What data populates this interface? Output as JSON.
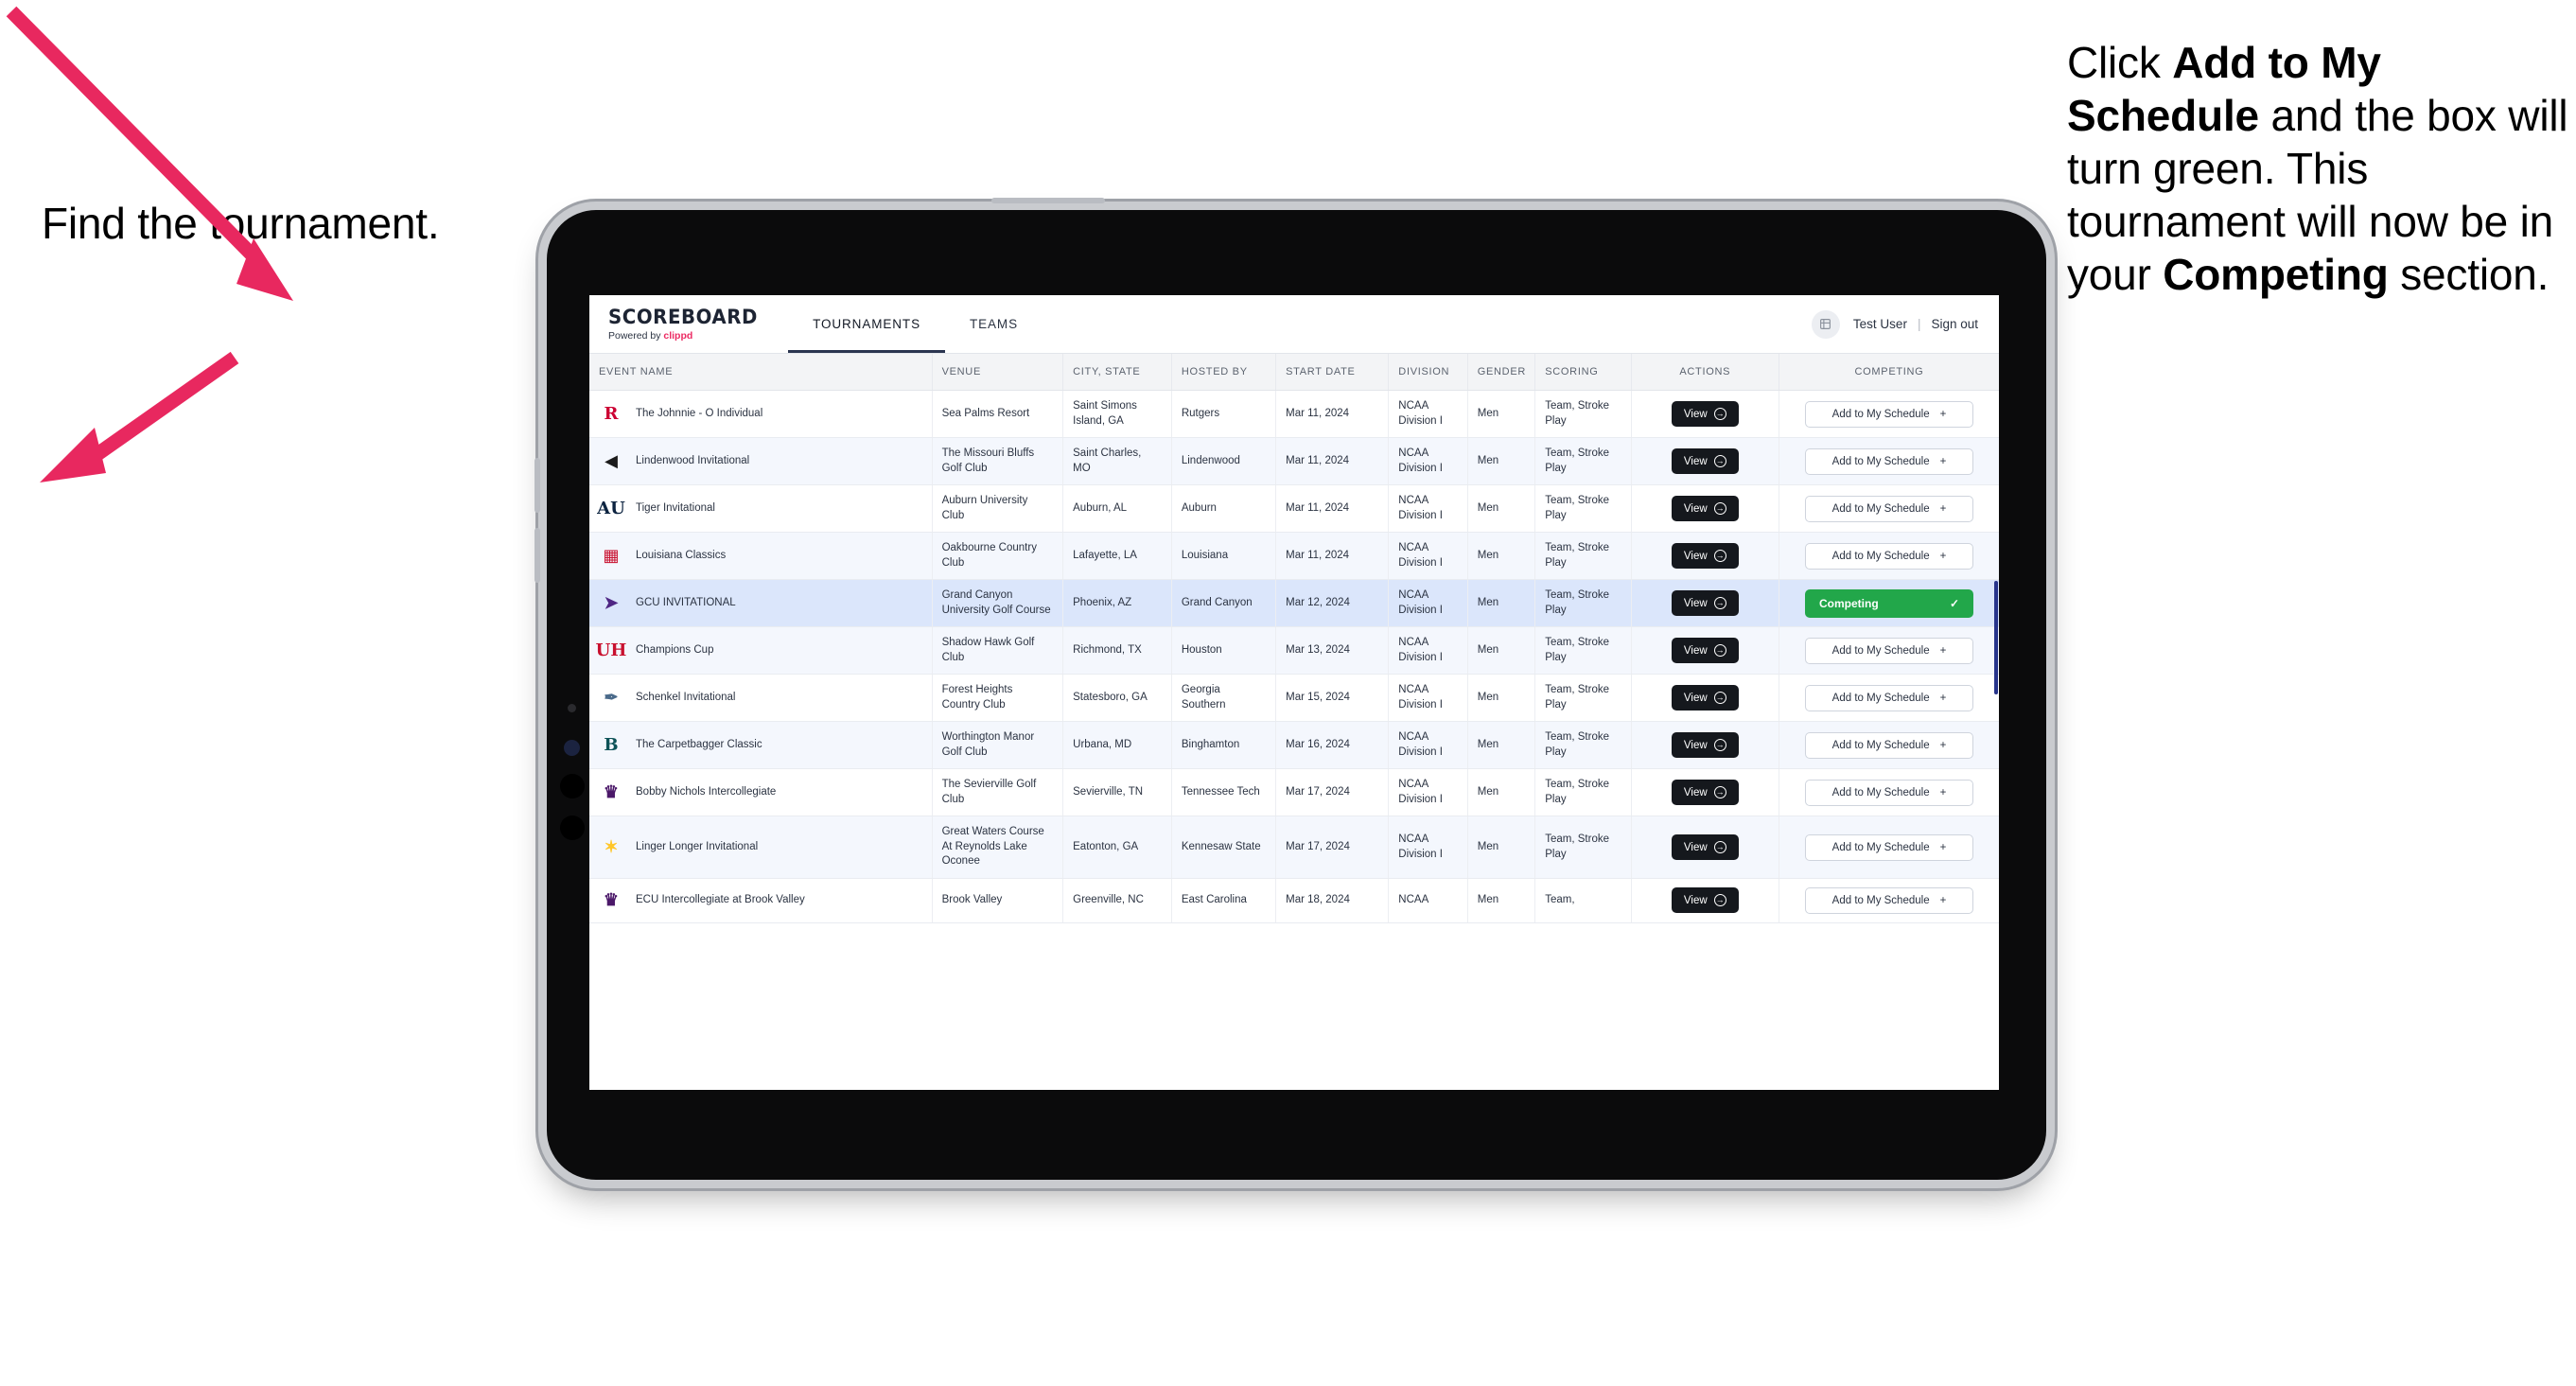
{
  "annotations": {
    "left": [
      {
        "t": "Find the tournament.",
        "b": false
      }
    ],
    "right": [
      {
        "t": "Click ",
        "b": false
      },
      {
        "t": "Add to My Schedule",
        "b": true
      },
      {
        "t": " and the box will turn green. This tournament will now be in your ",
        "b": false
      },
      {
        "t": "Competing",
        "b": true
      },
      {
        "t": " section.",
        "b": false
      }
    ],
    "arrow_color": "#E8285F"
  },
  "app": {
    "brand": {
      "name": "SCOREBOARD",
      "powered_prefix": "Powered by ",
      "powered_brand": "clippd"
    },
    "tabs": [
      {
        "label": "TOURNAMENTS",
        "active": true
      },
      {
        "label": "TEAMS",
        "active": false
      }
    ],
    "user": {
      "name": "Test User",
      "separator": "|",
      "signout": "Sign out",
      "avatar_icon": "user-avatar-icon"
    }
  },
  "table": {
    "columns": [
      "EVENT NAME",
      "VENUE",
      "CITY, STATE",
      "HOSTED BY",
      "START DATE",
      "DIVISION",
      "GENDER",
      "SCORING",
      "ACTIONS",
      "COMPETING"
    ],
    "buttons": {
      "view": "View",
      "add": "Add to My Schedule",
      "add_glyph": "+",
      "competing": "Competing",
      "competing_glyph": "✓",
      "view_glyph": "→"
    },
    "rows": [
      {
        "logo": {
          "text": "R",
          "color": "#CC0033",
          "name": "rutgers-logo"
        },
        "event": "The Johnnie - O Individual",
        "venue": "Sea Palms Resort",
        "city": "Saint Simons Island, GA",
        "hosted_by": "Rutgers",
        "start_date": "Mar 11, 2024",
        "division": "NCAA Division I",
        "gender": "Men",
        "scoring": "Team, Stroke Play",
        "competing": false
      },
      {
        "logo": {
          "text": "◀",
          "color": "#1b1b1b",
          "name": "lindenwood-logo"
        },
        "event": "Lindenwood Invitational",
        "venue": "The Missouri Bluffs Golf Club",
        "city": "Saint Charles, MO",
        "hosted_by": "Lindenwood",
        "start_date": "Mar 11, 2024",
        "division": "NCAA Division I",
        "gender": "Men",
        "scoring": "Team, Stroke Play",
        "competing": false
      },
      {
        "logo": {
          "text": "AU",
          "color": "#0C2340",
          "name": "auburn-logo"
        },
        "event": "Tiger Invitational",
        "venue": "Auburn University Club",
        "city": "Auburn, AL",
        "hosted_by": "Auburn",
        "start_date": "Mar 11, 2024",
        "division": "NCAA Division I",
        "gender": "Men",
        "scoring": "Team, Stroke Play",
        "competing": false
      },
      {
        "logo": {
          "text": "▦",
          "color": "#C8102E",
          "name": "louisiana-ragin-cajuns-logo"
        },
        "event": "Louisiana Classics",
        "venue": "Oakbourne Country Club",
        "city": "Lafayette, LA",
        "hosted_by": "Louisiana",
        "start_date": "Mar 11, 2024",
        "division": "NCAA Division I",
        "gender": "Men",
        "scoring": "Team, Stroke Play",
        "competing": false
      },
      {
        "logo": {
          "text": "➤",
          "color": "#4F2683",
          "name": "grand-canyon-lopes-logo"
        },
        "event": "GCU INVITATIONAL",
        "venue": "Grand Canyon University Golf Course",
        "city": "Phoenix, AZ",
        "hosted_by": "Grand Canyon",
        "start_date": "Mar 12, 2024",
        "division": "NCAA Division I",
        "gender": "Men",
        "scoring": "Team, Stroke Play",
        "competing": true,
        "selected": true
      },
      {
        "logo": {
          "text": "UH",
          "color": "#C8102E",
          "name": "houston-cougars-logo"
        },
        "event": "Champions Cup",
        "venue": "Shadow Hawk Golf Club",
        "city": "Richmond, TX",
        "hosted_by": "Houston",
        "start_date": "Mar 13, 2024",
        "division": "NCAA Division I",
        "gender": "Men",
        "scoring": "Team, Stroke Play",
        "competing": false
      },
      {
        "logo": {
          "text": "✒",
          "color": "#4A6A8A",
          "name": "georgia-southern-logo"
        },
        "event": "Schenkel Invitational",
        "venue": "Forest Heights Country Club",
        "city": "Statesboro, GA",
        "hosted_by": "Georgia Southern",
        "start_date": "Mar 15, 2024",
        "division": "NCAA Division I",
        "gender": "Men",
        "scoring": "Team, Stroke Play",
        "competing": false
      },
      {
        "logo": {
          "text": "B",
          "color": "#0D5257",
          "name": "binghamton-bearcats-logo"
        },
        "event": "The Carpetbagger Classic",
        "venue": "Worthington Manor Golf Club",
        "city": "Urbana, MD",
        "hosted_by": "Binghamton",
        "start_date": "Mar 16, 2024",
        "division": "NCAA Division I",
        "gender": "Men",
        "scoring": "Team, Stroke Play",
        "competing": false
      },
      {
        "logo": {
          "text": "♛",
          "color": "#4B1869",
          "name": "tennessee-tech-golden-eagles-logo"
        },
        "event": "Bobby Nichols Intercollegiate",
        "venue": "The Sevierville Golf Club",
        "city": "Sevierville, TN",
        "hosted_by": "Tennessee Tech",
        "start_date": "Mar 17, 2024",
        "division": "NCAA Division I",
        "gender": "Men",
        "scoring": "Team, Stroke Play",
        "competing": false
      },
      {
        "logo": {
          "text": "✶",
          "color": "#FFC629",
          "name": "kennesaw-state-owls-logo"
        },
        "event": "Linger Longer Invitational",
        "venue": "Great Waters Course At Reynolds Lake Oconee",
        "city": "Eatonton, GA",
        "hosted_by": "Kennesaw State",
        "start_date": "Mar 17, 2024",
        "division": "NCAA Division I",
        "gender": "Men",
        "scoring": "Team, Stroke Play",
        "competing": false
      },
      {
        "logo": {
          "text": "♛",
          "color": "#4B1869",
          "name": "east-carolina-logo"
        },
        "event": "ECU Intercollegiate at Brook Valley",
        "venue": "Brook Valley",
        "city": "Greenville, NC",
        "hosted_by": "East Carolina",
        "start_date": "Mar 18, 2024",
        "division": "NCAA",
        "gender": "Men",
        "scoring": "Team,",
        "competing": false,
        "partial": true
      }
    ]
  }
}
